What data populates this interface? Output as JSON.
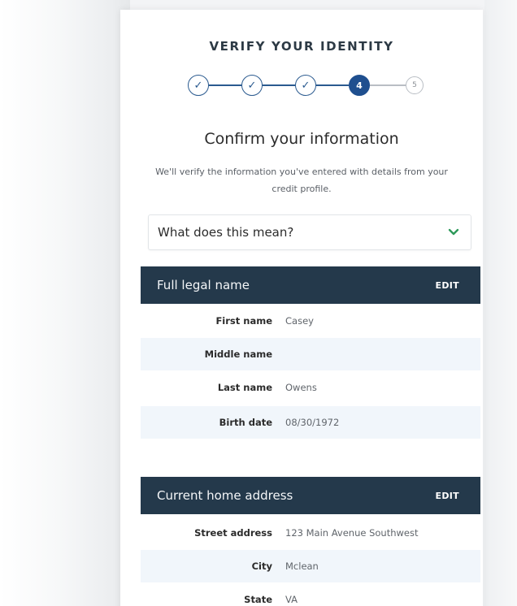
{
  "title": "VERIFY YOUR IDENTITY",
  "stepper": {
    "steps": [
      {
        "label": "✓",
        "state": "completed"
      },
      {
        "label": "✓",
        "state": "completed"
      },
      {
        "label": "✓",
        "state": "completed"
      },
      {
        "label": "4",
        "state": "current"
      },
      {
        "label": "5",
        "state": "upcoming"
      }
    ]
  },
  "heading": "Confirm your information",
  "intro": "We'll verify the information you've entered with details from your credit profile.",
  "accordion": {
    "label": "What does this mean?",
    "icon": "chevron-down-icon",
    "icon_color": "#2e9a5a"
  },
  "colors": {
    "header_bg": "#24394b",
    "alt_row_bg": "#f1f6fb",
    "step_active": "#1f4f8f"
  },
  "sections": [
    {
      "title": "Full legal name",
      "edit_label": "EDIT",
      "rows": [
        {
          "label": "First name",
          "value": "Casey"
        },
        {
          "label": "Middle name",
          "value": ""
        },
        {
          "label": "Last name",
          "value": "Owens"
        },
        {
          "label": "Birth date",
          "value": "08/30/1972"
        }
      ]
    },
    {
      "title": "Current home address",
      "edit_label": "EDIT",
      "rows": [
        {
          "label": "Street address",
          "value": "123 Main Avenue Southwest"
        },
        {
          "label": "City",
          "value": "Mclean"
        },
        {
          "label": "State",
          "value": "VA"
        }
      ]
    }
  ]
}
